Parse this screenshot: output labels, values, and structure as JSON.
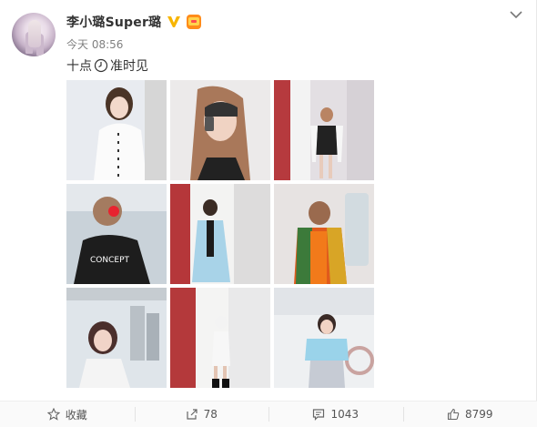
{
  "post": {
    "author": "李小璐Super璐",
    "time": "今天 08:56",
    "text_before": "十点",
    "text_after": "准时见"
  },
  "photos": [
    {
      "label": "photo-1"
    },
    {
      "label": "photo-2"
    },
    {
      "label": "photo-3"
    },
    {
      "label": "photo-4"
    },
    {
      "label": "photo-5"
    },
    {
      "label": "photo-6"
    },
    {
      "label": "photo-7"
    },
    {
      "label": "photo-8"
    },
    {
      "label": "photo-9"
    }
  ],
  "footer": {
    "favorite_label": "收藏",
    "repost_count": "78",
    "comment_count": "1043",
    "like_count": "8799"
  },
  "colors": {
    "verified_badge": "#f7b500",
    "text": "#333333",
    "muted": "#808080"
  },
  "icons": [
    "verified-v-icon",
    "rank-badge-icon",
    "chevron-down-icon",
    "clock-emoji-icon",
    "star-icon",
    "repost-icon",
    "comment-icon",
    "thumbs-up-icon"
  ]
}
